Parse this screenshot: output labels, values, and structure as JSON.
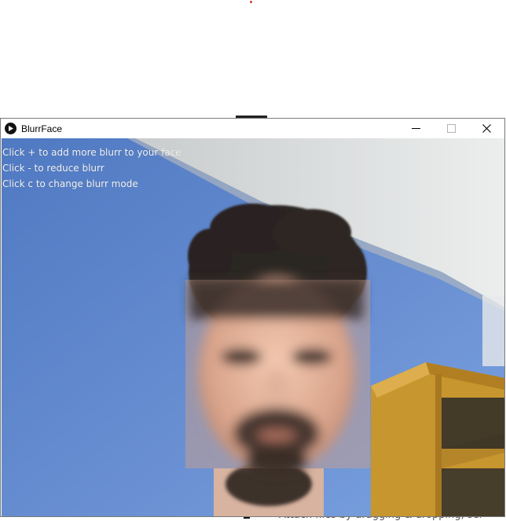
{
  "window": {
    "title": "BlurrFace",
    "controls": {
      "minimize_icon": "minimize-icon",
      "maximize_icon": "maximize-icon",
      "close_icon": "close-icon"
    }
  },
  "overlay": {
    "lines": [
      "Click + to add more blurr to your face",
      "Click - to reduce blurr",
      "Click c to change blurr mode"
    ]
  },
  "background": {
    "partial_text": "Attach files by dragging & dropping, sel"
  },
  "colors": {
    "wall": "#5b82c6",
    "ceiling": "#dcdedd",
    "shelf": "#c8962e",
    "overlay_text": "#f4f4f4"
  }
}
